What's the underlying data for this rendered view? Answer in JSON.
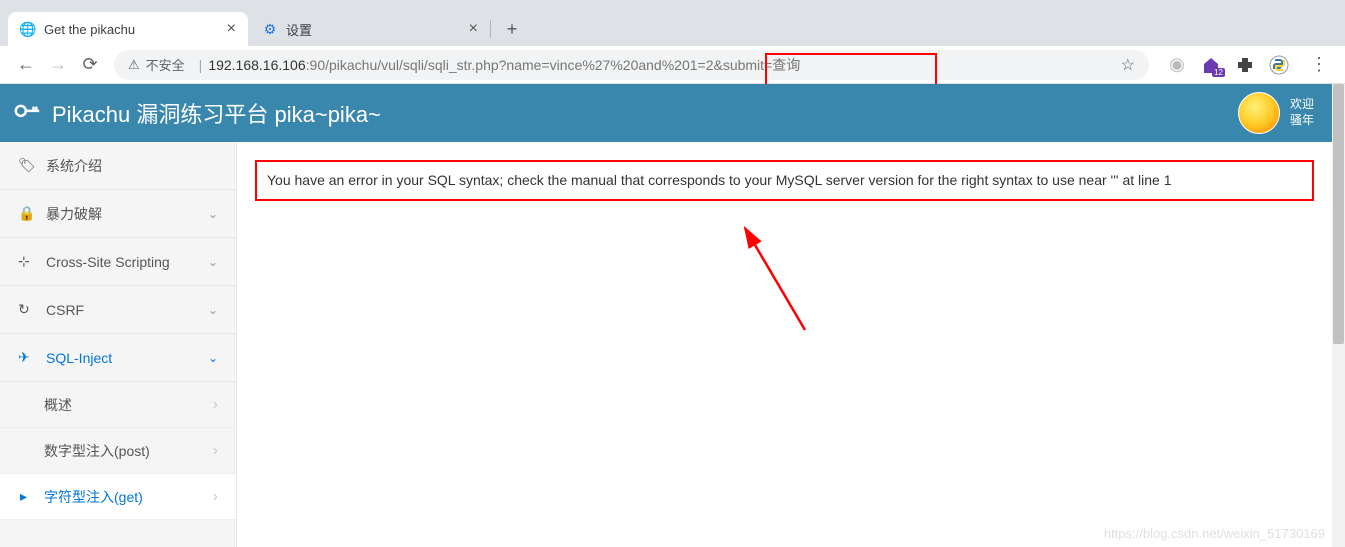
{
  "window": {
    "minimize": "—",
    "maximize": "☐",
    "close": "✕"
  },
  "tabs": {
    "items": [
      {
        "favicon": "◉",
        "title": "Get the pikachu",
        "active": true
      },
      {
        "favicon": "⚙",
        "title": "设置",
        "active": false
      }
    ],
    "new_tab": "+"
  },
  "toolbar": {
    "back": "←",
    "forward": "→",
    "reload": "⟳",
    "insecure_label": "不安全",
    "url_host": "192.168.16.106",
    "url_port_path": ":90/pikachu/vul/sqli/sqli_str.php?name=vince",
    "url_highlighted": "%27%20and%201=2",
    "url_rest": "&submit=查询",
    "star": "☆",
    "menu": "⋮"
  },
  "extensions": {
    "profile_dot": "●",
    "home_badge": "12",
    "puzzle": "✦",
    "python": "◐"
  },
  "annotation": {
    "text": "' and 1=2"
  },
  "header": {
    "title": "Pikachu 漏洞练习平台 pika~pika~",
    "welcome_l1": "欢迎",
    "welcome_l2": "骚年"
  },
  "sidebar": {
    "items": [
      {
        "icon": "🏷",
        "label": "系统介绍",
        "chev": ""
      },
      {
        "icon": "🔒",
        "label": "暴力破解",
        "chev": "⌄"
      },
      {
        "icon": "⊹",
        "label": "Cross-Site Scripting",
        "chev": "⌄"
      },
      {
        "icon": "↻",
        "label": "CSRF",
        "chev": "⌄"
      },
      {
        "icon": "✈",
        "label": "SQL-Inject",
        "chev": "⌄",
        "active": true
      }
    ],
    "sub": [
      {
        "label": "概述"
      },
      {
        "label": "数字型注入(post)"
      },
      {
        "label": "字符型注入(get)",
        "current": true
      }
    ]
  },
  "main": {
    "error": "You have an error in your SQL syntax; check the manual that corresponds to your MySQL server version for the right syntax to use near ''' at line 1"
  },
  "watermark": "https://blog.csdn.net/weixin_51730169"
}
